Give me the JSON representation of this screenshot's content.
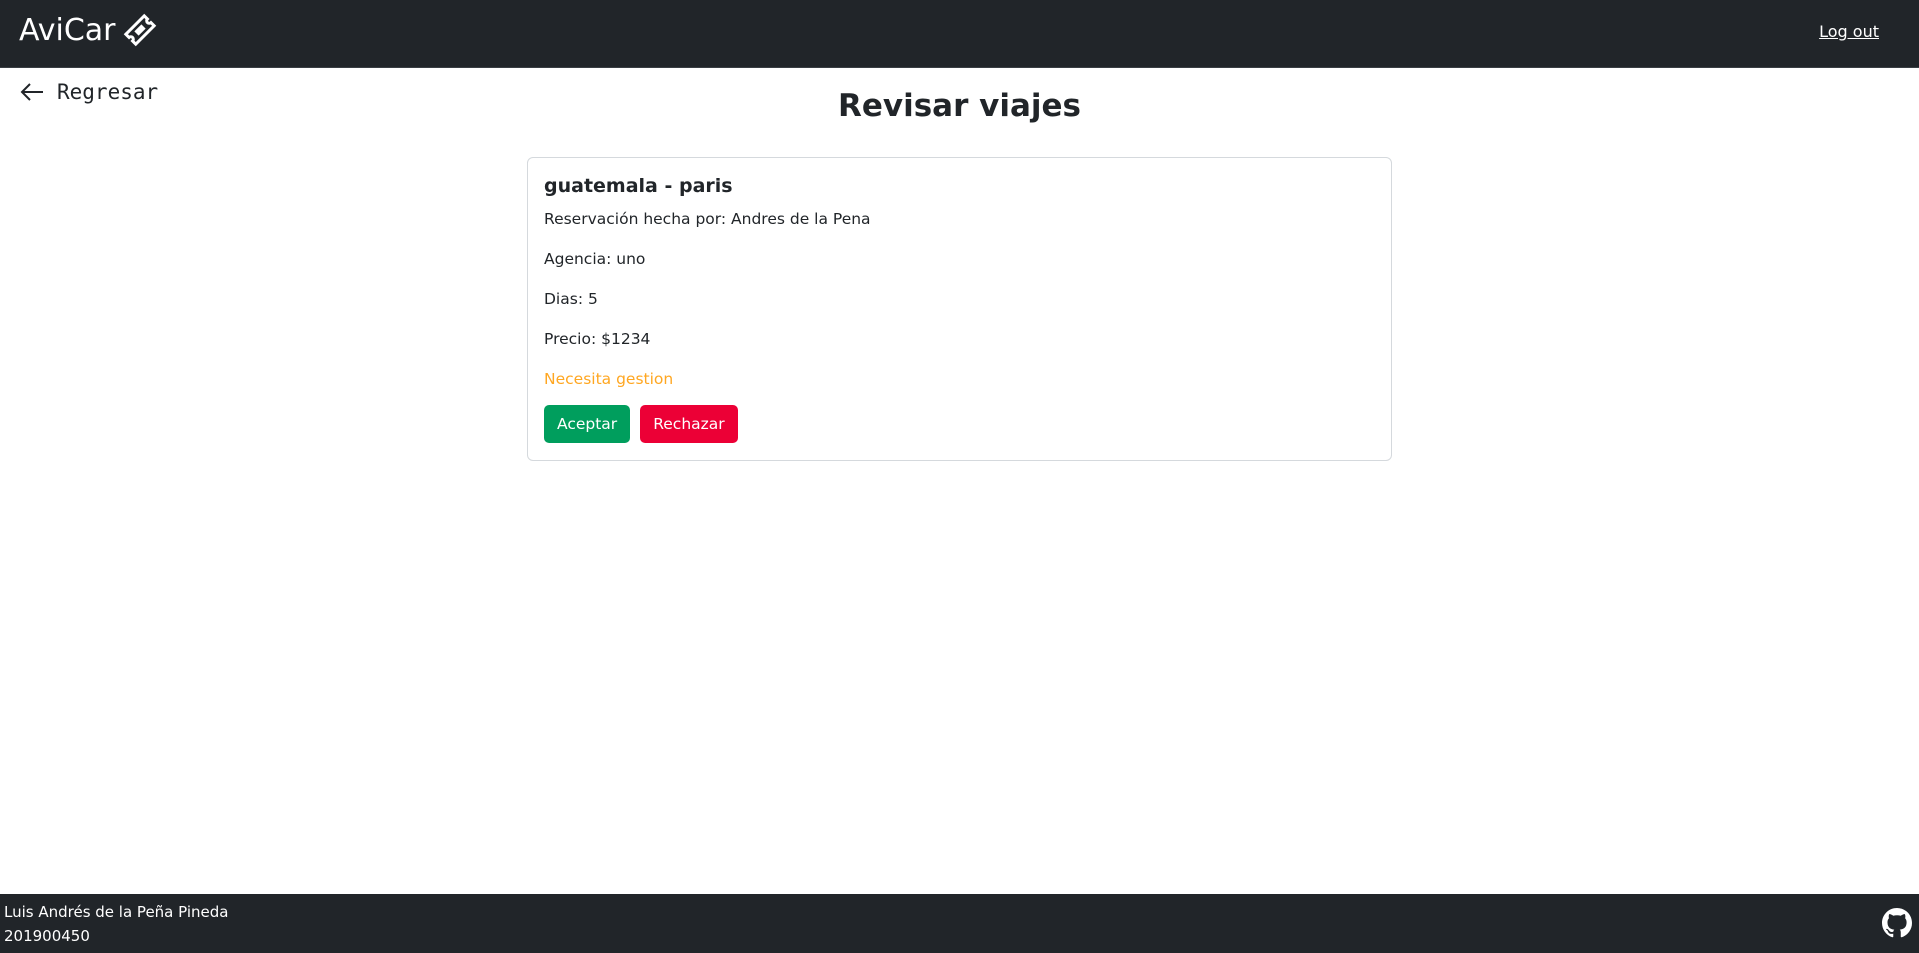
{
  "navbar": {
    "brand": "AviCar",
    "brand_icon": "ticket-icon",
    "logout_label": "Log out"
  },
  "back": {
    "label": "Regresar",
    "icon": "arrow-left-icon"
  },
  "page": {
    "title": "Revisar viajes"
  },
  "trip": {
    "title": "guatemala - paris",
    "reserved_by": "Reservación hecha por: Andres de la Pena",
    "agency": "Agencia: uno",
    "days": "Dias: 5",
    "price": "Precio: $1234",
    "status": "Necesita gestion",
    "status_color": "#ffa722",
    "accept_label": "Aceptar",
    "reject_label": "Rechazar"
  },
  "footer": {
    "name": "Luis Andrés de la Peña Pineda",
    "id": "201900450",
    "icon": "github-icon"
  },
  "colors": {
    "navbar_bg": "#212529",
    "accept": "#009e5d",
    "reject": "#ec0036"
  }
}
